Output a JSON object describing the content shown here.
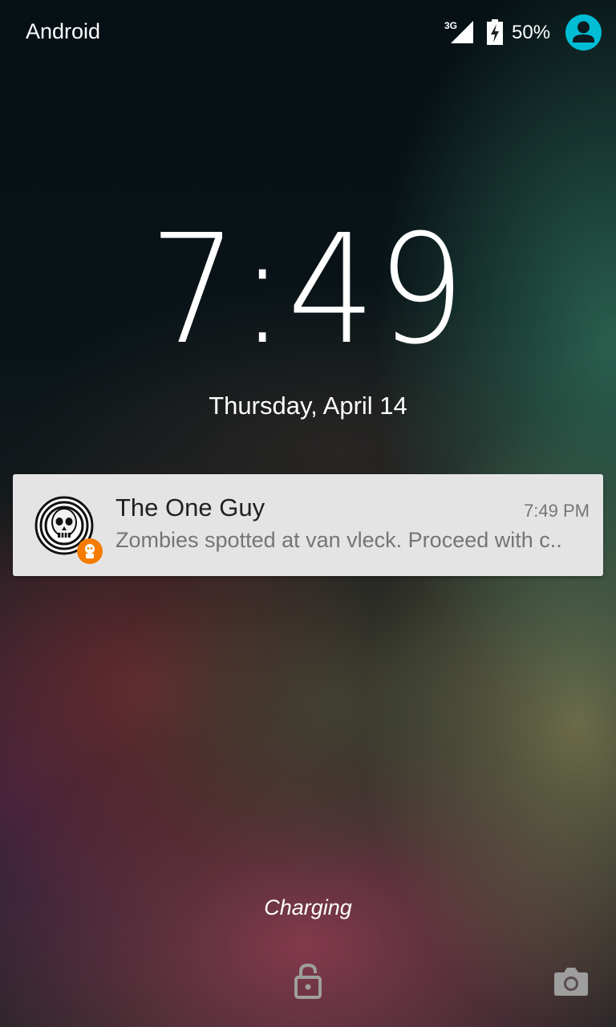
{
  "status_bar": {
    "carrier": "Android",
    "network_type": "3G",
    "battery_percent": "50%",
    "signal_icon": "signal-icon",
    "battery_icon": "battery-charging-icon",
    "user_icon": "user-icon",
    "accent_color": "#00BCD4"
  },
  "clock": {
    "time": "7:49",
    "date": "Thursday, April 14"
  },
  "notification": {
    "title": "The One Guy",
    "time": "7:49 PM",
    "text": "Zombies spotted at van vleck. Proceed with c..",
    "avatar_icon": "skull-avatar-icon",
    "badge_icon": "app-badge-icon",
    "badge_color": "#F57C00"
  },
  "footer": {
    "status": "Charging",
    "lock_icon": "unlock-icon",
    "camera_icon": "camera-icon"
  }
}
